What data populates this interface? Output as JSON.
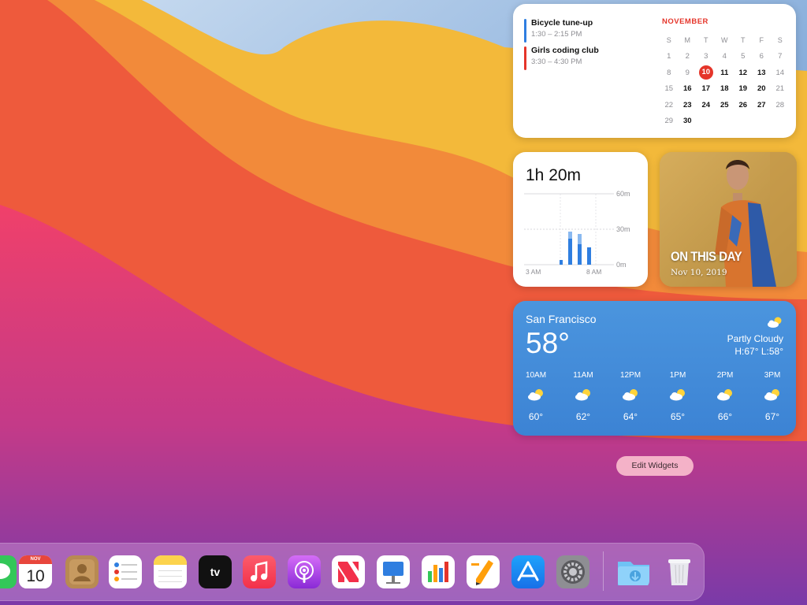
{
  "calendar": {
    "events": [
      {
        "title": "Bicycle tune-up",
        "time": "1:30 – 2:15 PM",
        "color": "#2f7ee0"
      },
      {
        "title": "Girls coding club",
        "time": "3:30 – 4:30 PM",
        "color": "#e5352a"
      }
    ],
    "month": "NOVEMBER",
    "weekdays": [
      "S",
      "M",
      "T",
      "W",
      "T",
      "F",
      "S"
    ],
    "weeks": [
      [
        "1",
        "2",
        "3",
        "4",
        "5",
        "6",
        "7"
      ],
      [
        "8",
        "9",
        "10",
        "11",
        "12",
        "13",
        "14"
      ],
      [
        "15",
        "16",
        "17",
        "18",
        "19",
        "20",
        "21"
      ],
      [
        "22",
        "23",
        "24",
        "25",
        "26",
        "27",
        "28"
      ],
      [
        "29",
        "30",
        "",
        "",
        "",
        "",
        ""
      ]
    ],
    "today": "10"
  },
  "screentime": {
    "total": "1h 20m",
    "y_labels": [
      "60m",
      "30m",
      "0m"
    ],
    "x_labels": [
      "3 AM",
      "8 AM"
    ]
  },
  "photo": {
    "title": "ON THIS DAY",
    "date": "Nov 10, 2019"
  },
  "weather": {
    "city": "San Francisco",
    "temp": "58°",
    "condition": "Partly Cloudy",
    "hilo": "H:67° L:58°",
    "hourly": [
      {
        "hour": "10AM",
        "temp": "60°"
      },
      {
        "hour": "11AM",
        "temp": "62°"
      },
      {
        "hour": "12PM",
        "temp": "64°"
      },
      {
        "hour": "1PM",
        "temp": "65°"
      },
      {
        "hour": "2PM",
        "temp": "66°"
      },
      {
        "hour": "3PM",
        "temp": "67°"
      }
    ]
  },
  "edit_widgets": "Edit Widgets",
  "dock": {
    "calendar_month": "NOV",
    "calendar_day": "10",
    "tv_label": "tv",
    "apps": [
      "Messages",
      "Calendar",
      "Contacts",
      "Reminders",
      "Notes",
      "TV",
      "Music",
      "Podcasts",
      "News",
      "Keynote",
      "Numbers",
      "Pages",
      "App Store",
      "System Preferences",
      "Downloads",
      "Trash"
    ]
  },
  "colors": {
    "accent_red": "#e5352a",
    "weather_blue": "#3c83d4",
    "screentime_blue": "#2f7ee0"
  }
}
